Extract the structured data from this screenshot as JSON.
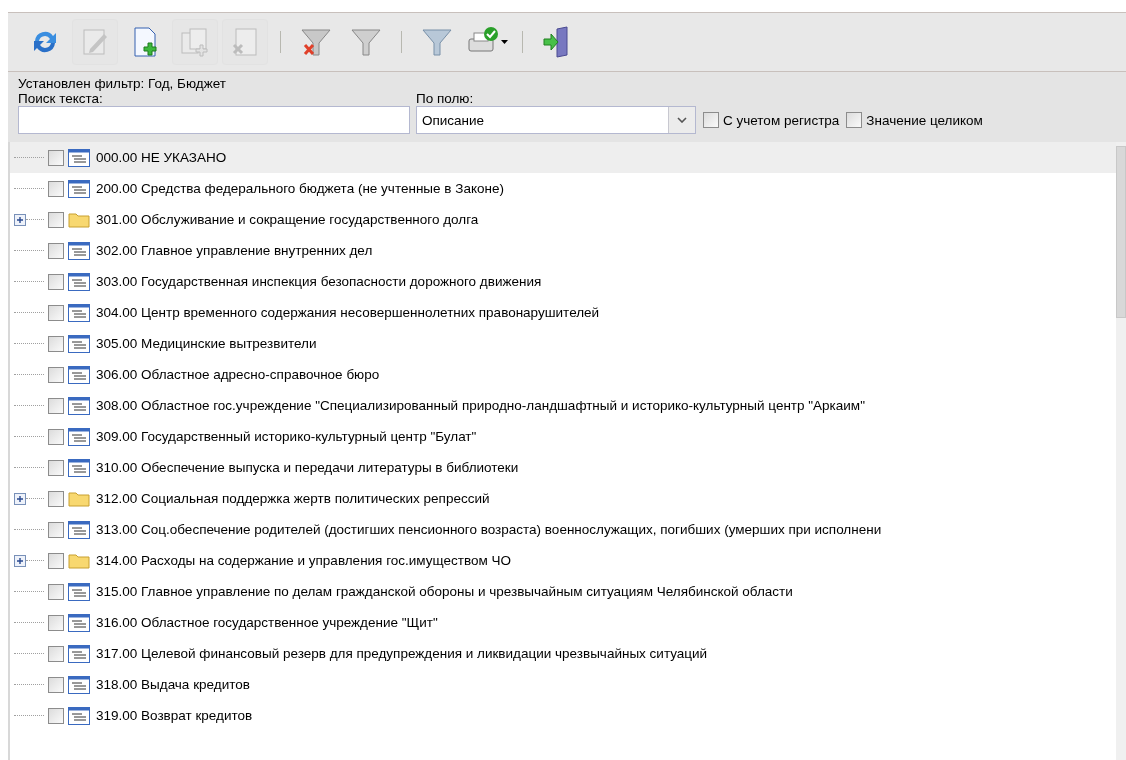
{
  "toolbar": [
    {
      "kind": "refresh",
      "disabled": false
    },
    {
      "kind": "edit",
      "disabled": true
    },
    {
      "kind": "new",
      "disabled": false
    },
    {
      "kind": "copy",
      "disabled": true
    },
    {
      "kind": "delete",
      "disabled": true
    },
    {
      "kind": "separator"
    },
    {
      "kind": "filter-clear",
      "disabled": false
    },
    {
      "kind": "filter",
      "disabled": false
    },
    {
      "kind": "separator"
    },
    {
      "kind": "filter-set",
      "disabled": false
    },
    {
      "kind": "print",
      "disabled": false,
      "dropdown": true
    },
    {
      "kind": "separator"
    },
    {
      "kind": "exit",
      "disabled": false
    }
  ],
  "filter_status": "Установлен фильтр: Год, Бюджет",
  "search": {
    "label": "Поиск текста:"
  },
  "field_select": {
    "label": "По полю:",
    "value": "Описание"
  },
  "options": [
    {
      "label": "С учетом регистра",
      "checked": false
    },
    {
      "label": "Значение целиком",
      "checked": false
    }
  ],
  "tree": [
    {
      "kind": "item",
      "label": "000.00 НЕ УКАЗАНО",
      "checked": false,
      "selected": true
    },
    {
      "kind": "item",
      "label": "200.00 Средства федерального бюджета (не учтенные в Законе)",
      "checked": false,
      "selected": false
    },
    {
      "kind": "folder",
      "label": "301.00 Обслуживание и сокращение государственного долга",
      "checked": false,
      "selected": false,
      "expanded": false
    },
    {
      "kind": "item",
      "label": "302.00 Главное управление внутренних дел",
      "checked": false,
      "selected": false
    },
    {
      "kind": "item",
      "label": "303.00 Государственная инспекция безопасности дорожного движения",
      "checked": false,
      "selected": false
    },
    {
      "kind": "item",
      "label": "304.00 Центр временного содержания несовершеннолетних правонарушителей",
      "checked": false,
      "selected": false
    },
    {
      "kind": "item",
      "label": "305.00 Медицинские вытрезвители",
      "checked": false,
      "selected": false
    },
    {
      "kind": "item",
      "label": "306.00 Областное адресно-справочное бюро",
      "checked": false,
      "selected": false
    },
    {
      "kind": "item",
      "label": "308.00 Областное гос.учреждение \"Специализированный природно-ландшафтный и историко-культурный центр \"Аркаим\"",
      "checked": false,
      "selected": false
    },
    {
      "kind": "item",
      "label": "309.00 Государственный историко-культурный центр \"Булат\"",
      "checked": false,
      "selected": false
    },
    {
      "kind": "item",
      "label": "310.00 Обеспечение выпуска и передачи литературы в библиотеки",
      "checked": false,
      "selected": false
    },
    {
      "kind": "folder",
      "label": "312.00 Социальная поддержка жертв политических репрессий",
      "checked": false,
      "selected": false,
      "expanded": false
    },
    {
      "kind": "item",
      "label": "313.00 Соц.обеспечение родителей (достигших пенсионного возраста) военнослужащих, погибших (умерших при исполнени",
      "checked": false,
      "selected": false
    },
    {
      "kind": "folder",
      "label": "314.00 Расходы на содержание и управления гос.имуществом ЧО",
      "checked": false,
      "selected": false,
      "expanded": false
    },
    {
      "kind": "item",
      "label": "315.00 Главное управление по делам гражданской обороны и чрезвычайным ситуациям Челябинской области",
      "checked": false,
      "selected": false
    },
    {
      "kind": "item",
      "label": "316.00 Областное государственное учреждение \"Щит\"",
      "checked": false,
      "selected": false
    },
    {
      "kind": "item",
      "label": "317.00 Целевой финансовый резерв для предупреждения и ликвидации чрезвычайных ситуаций",
      "checked": false,
      "selected": false
    },
    {
      "kind": "item",
      "label": "318.00 Выдача кредитов",
      "checked": false,
      "selected": false
    },
    {
      "kind": "item",
      "label": "319.00 Возврат кредитов",
      "checked": false,
      "selected": false
    }
  ]
}
